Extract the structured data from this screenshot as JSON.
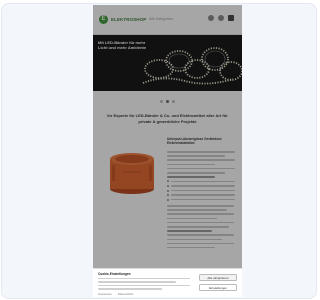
{
  "header": {
    "logo_initial": "E",
    "logo_text": "ELEKTROSHOP",
    "nav_link": "Alle Kategorien",
    "icons": [
      "search-icon",
      "account-icon",
      "cart-icon"
    ]
  },
  "hero": {
    "title": "Mit LED-Bänder für mehr Licht und mehr Ambiente"
  },
  "slider": {
    "dot_count": 3,
    "active_index": 1
  },
  "content": {
    "headline": "Ihr Experte für LED-Bänder & Co. und Elektroartikel aller Art für private & gewerbliche Projekte",
    "product_icon": "junction-box-image",
    "product_title": "Unterputz-Abzweigdose Gerätedose Elektroinstallation"
  },
  "cookie": {
    "title": "Cookie-Einstellungen",
    "accept_label": "Alle akzeptieren",
    "settings_label": "Einstellungen",
    "links": [
      "Impressum",
      "Datenschutz"
    ]
  },
  "colors": {
    "card_bg": "#f3f6fb",
    "hero_bg": "#0f0f0f",
    "brand_green": "#3a9a3a",
    "product_orange": "#e2642b"
  }
}
